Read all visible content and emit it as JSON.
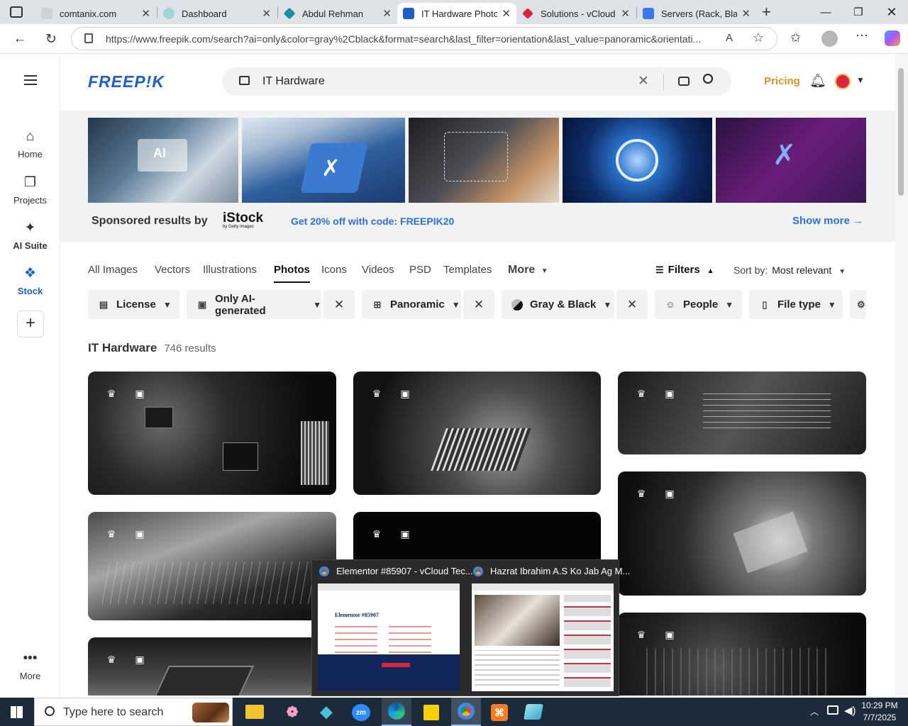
{
  "browser": {
    "tabs": [
      {
        "title": "comtanix.com",
        "active": false
      },
      {
        "title": "Dashboard",
        "active": false
      },
      {
        "title": "Abdul Rehman",
        "active": false
      },
      {
        "title": "IT Hardware Photos",
        "active": true
      },
      {
        "title": "Solutions - vCloud T",
        "active": false
      },
      {
        "title": "Servers (Rack, Blade",
        "active": false
      }
    ],
    "url": "https://www.freepik.com/search?ai=only&color=gray%2Cblack&format=search&last_filter=orientation&last_value=panoramic&orientati..."
  },
  "freepik": {
    "logo": "FREEP!K",
    "search_value": "IT Hardware",
    "pricing": "Pricing",
    "sidebar": [
      {
        "label": "Home",
        "icon": "home-icon"
      },
      {
        "label": "Projects",
        "icon": "projects-icon"
      },
      {
        "label": "AI Suite",
        "icon": "ai-suite-icon"
      },
      {
        "label": "Stock",
        "icon": "stock-icon",
        "active": true
      },
      {
        "label": "More",
        "icon": "more-icon"
      }
    ],
    "sponsor": {
      "text": "Sponsored results by",
      "brand": "iStock",
      "brand_sub": "by Getty Images",
      "promo": "Get 20% off with code: FREEPIK20",
      "show_more": "Show more →"
    },
    "categories": [
      "All Images",
      "Vectors",
      "Illustrations",
      "Photos",
      "Icons",
      "Videos",
      "PSD",
      "Templates",
      "More"
    ],
    "active_category": "Photos",
    "filters_label": "Filters",
    "sort_label": "Sort by:",
    "sort_value": "Most relevant",
    "chips": [
      {
        "label": "License"
      },
      {
        "label": "Only AI-generated"
      },
      {
        "label": "Panoramic"
      },
      {
        "label": "Gray & Black"
      },
      {
        "label": "People"
      },
      {
        "label": "File type"
      }
    ],
    "results_title": "IT Hardware",
    "results_count": "746 results"
  },
  "preview": [
    {
      "title": "Elementor #85907 - vCloud Tec...",
      "shot_heading": "Elementor #85907"
    },
    {
      "title": "Hazrat Ibrahim A.S Ko Jab Ag M..."
    }
  ],
  "taskbar": {
    "search_placeholder": "Type here to search",
    "time": "10:29 PM",
    "date": "7/7/2025"
  },
  "colors": {
    "accent": "#1f5fc9",
    "pricing": "#e0932a",
    "link": "#2e6fd4",
    "taskbar": "#1c2a3a"
  }
}
